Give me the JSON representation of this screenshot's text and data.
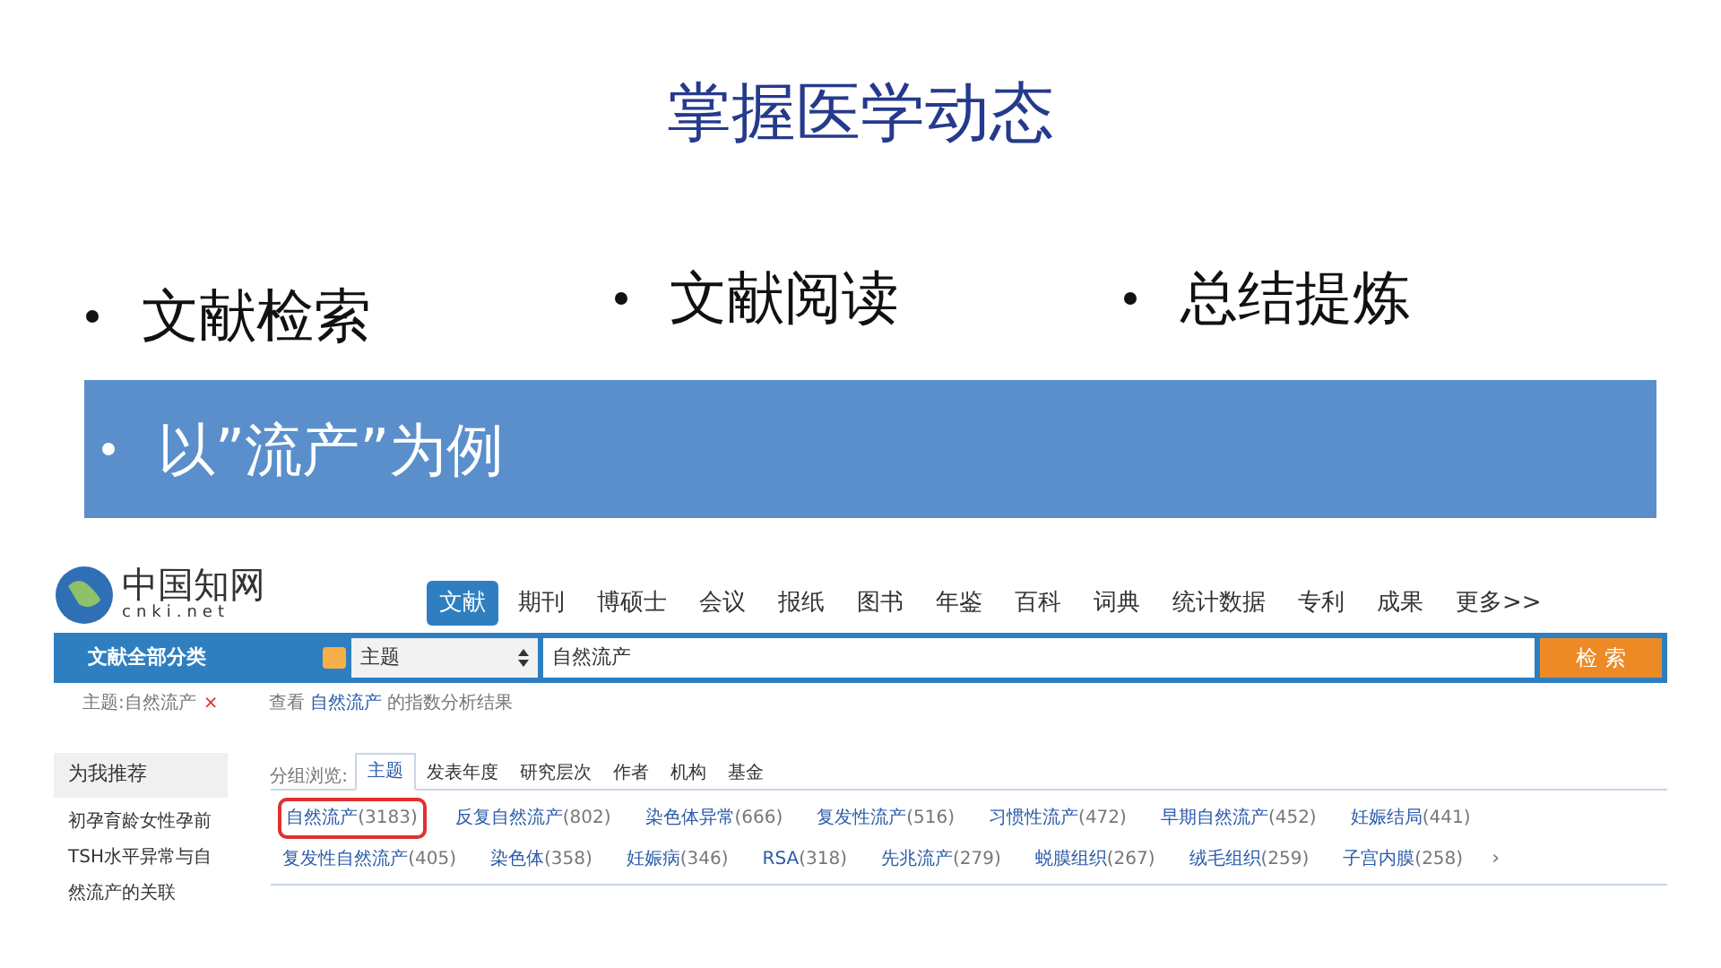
{
  "slide": {
    "title": "掌握医学动态",
    "bullets": [
      {
        "text": "文献检索",
        "highlighted": false
      },
      {
        "text": "文献阅读",
        "highlighted": false
      },
      {
        "text": "总结提炼",
        "highlighted": false
      },
      {
        "text": "以”流产”为例",
        "highlighted": true
      }
    ]
  },
  "site": {
    "logo_text": "中国知网",
    "logo_sub": "cnki.net",
    "nav_tabs": [
      {
        "label": "文献",
        "selected": true
      },
      {
        "label": "期刊",
        "selected": false
      },
      {
        "label": "博硕士",
        "selected": false
      },
      {
        "label": "会议",
        "selected": false
      },
      {
        "label": "报纸",
        "selected": false
      },
      {
        "label": "图书",
        "selected": false
      },
      {
        "label": "年鉴",
        "selected": false
      },
      {
        "label": "百科",
        "selected": false
      },
      {
        "label": "词典",
        "selected": false
      },
      {
        "label": "统计数据",
        "selected": false
      },
      {
        "label": "专利",
        "selected": false
      },
      {
        "label": "成果",
        "selected": false
      },
      {
        "label": "更多>>",
        "selected": false
      }
    ],
    "category": "文献全部分类",
    "field": "主题",
    "query": "自然流产",
    "search_button": "检 索",
    "filter": {
      "tag": "主题:自然流产",
      "remove": "×",
      "prefix": "查看",
      "term": "自然流产",
      "suffix": "的指数分析结果"
    },
    "recommend": {
      "title": "为我推荐",
      "items": [
        "初孕育龄女性孕前TSH水平异常与自然流产的关联"
      ]
    },
    "browse": {
      "label": "分组浏览:",
      "tabs": [
        {
          "label": "主题",
          "selected": true
        },
        {
          "label": "发表年度",
          "selected": false
        },
        {
          "label": "研究层次",
          "selected": false
        },
        {
          "label": "作者",
          "selected": false
        },
        {
          "label": "机构",
          "selected": false
        },
        {
          "label": "基金",
          "selected": false
        }
      ],
      "topics": [
        {
          "name": "自然流产",
          "count": "(3183)",
          "circled": true
        },
        {
          "name": "反复自然流产",
          "count": "(802)",
          "circled": false
        },
        {
          "name": "染色体异常",
          "count": "(666)",
          "circled": false
        },
        {
          "name": "复发性流产",
          "count": "(516)",
          "circled": false
        },
        {
          "name": "习惯性流产",
          "count": "(472)",
          "circled": false
        },
        {
          "name": "早期自然流产",
          "count": "(452)",
          "circled": false
        },
        {
          "name": "妊娠结局",
          "count": "(441)",
          "circled": false
        },
        {
          "name": "复发性自然流产",
          "count": "(405)",
          "circled": false
        },
        {
          "name": "染色体",
          "count": "(358)",
          "circled": false
        },
        {
          "name": "妊娠病",
          "count": "(346)",
          "circled": false
        },
        {
          "name": "RSA",
          "count": "(318)",
          "circled": false
        },
        {
          "name": "先兆流产",
          "count": "(279)",
          "circled": false
        },
        {
          "name": "蜕膜组织",
          "count": "(267)",
          "circled": false
        },
        {
          "name": "绒毛组织",
          "count": "(259)",
          "circled": false
        },
        {
          "name": "子宫内膜",
          "count": "(258)",
          "circled": false
        }
      ],
      "more": "›"
    }
  }
}
